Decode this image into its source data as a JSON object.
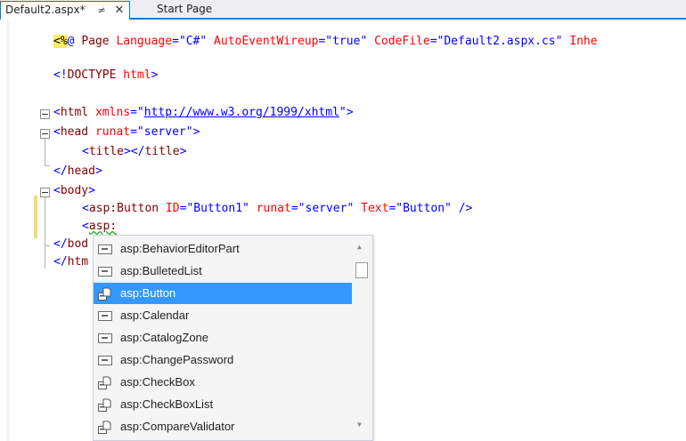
{
  "tabs": {
    "active": {
      "label": "Default2.aspx*",
      "pin": "≠",
      "close": "✕"
    },
    "inactive": {
      "label": "Start Page"
    }
  },
  "code": {
    "line1": {
      "directive_open": "<%",
      "directive_at": "@ ",
      "page_word": "Page ",
      "attr1": "Language",
      "val1": "=\"C#\"",
      "attr2": " AutoEventWireup",
      "val2": "=\"true\"",
      "attr3": " CodeFile",
      "val3": "=\"Default2.aspx.cs\"",
      "attr4": " Inhe"
    },
    "doctype": {
      "open": "<!",
      "name": "DOCTYPE",
      "rest": " html",
      "close": ">"
    },
    "html_open": {
      "lt": "<",
      "tag": "html",
      "attr": " xmlns",
      "eq": "=\"",
      "url": "http://www.w3.org/1999/xhtml",
      "close": "\">"
    },
    "head_open": {
      "lt": "<",
      "tag": "head",
      "attr": " runat",
      "val": "=\"server\"",
      "gt": ">"
    },
    "title_line": {
      "lt1": "<",
      "tag1": "title",
      "gt1": "></",
      "tag2": "title",
      "gt2": ">"
    },
    "head_close": {
      "lt": "</",
      "tag": "head",
      "gt": ">"
    },
    "body_open": {
      "lt": "<",
      "tag": "body",
      "gt": ">"
    },
    "button_line": {
      "lt": "<",
      "tag": "asp:Button",
      "attr1": " ID",
      "val1": "=\"Button1\"",
      "attr2": " runat",
      "val2": "=\"server\"",
      "attr3": " Text",
      "val3": "=\"Button\"",
      "close": " />"
    },
    "asp_line": {
      "lt": "<",
      "tag": "asp:"
    },
    "body_close": {
      "lt": "</",
      "tag": "bod"
    },
    "html_close": {
      "lt": "</",
      "tag": "htm"
    }
  },
  "completion": {
    "items": [
      {
        "label": "asp:BehaviorEditorPart",
        "icon": "class-icon"
      },
      {
        "label": "asp:BulletedList",
        "icon": "class-icon"
      },
      {
        "label": "asp:Button",
        "icon": "control-icon",
        "selected": true
      },
      {
        "label": "asp:Calendar",
        "icon": "class-icon"
      },
      {
        "label": "asp:CatalogZone",
        "icon": "class-icon"
      },
      {
        "label": "asp:ChangePassword",
        "icon": "class-icon"
      },
      {
        "label": "asp:CheckBox",
        "icon": "control-icon"
      },
      {
        "label": "asp:CheckBoxList",
        "icon": "control-icon"
      },
      {
        "label": "asp:CompareValidator",
        "icon": "control-icon"
      }
    ],
    "scroll_up": "▲",
    "scroll_down": "▼"
  },
  "colors": {
    "accent": "#007acc",
    "selection": "#3399ff",
    "tag": "#800000",
    "attribute": "#ff0000",
    "value": "#0000ff"
  }
}
